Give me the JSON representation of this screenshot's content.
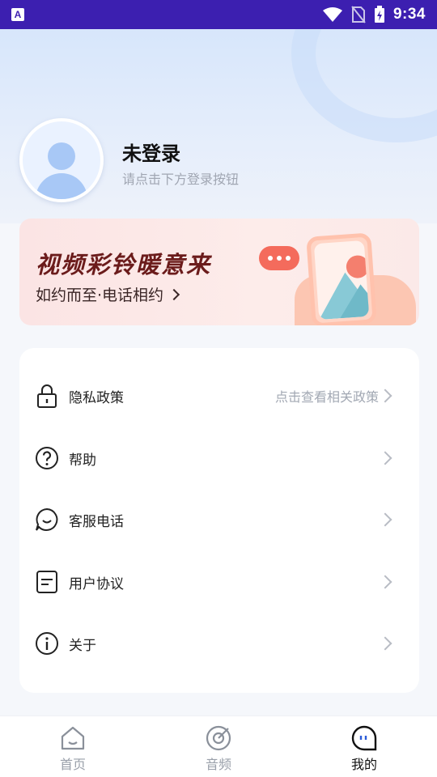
{
  "status_bar": {
    "time": "9:34",
    "app_badge": "A"
  },
  "profile": {
    "title": "未登录",
    "subtitle": "请点击下方登录按钮"
  },
  "banner": {
    "title": "视频彩铃暖意来",
    "subtitle": "如约而至·电话相约"
  },
  "menu": {
    "items": [
      {
        "label": "隐私政策",
        "hint": "点击查看相关政策",
        "icon": "lock-icon"
      },
      {
        "label": "帮助",
        "hint": "",
        "icon": "question-icon"
      },
      {
        "label": "客服电话",
        "hint": "",
        "icon": "chat-icon"
      },
      {
        "label": "用户协议",
        "hint": "",
        "icon": "document-icon"
      },
      {
        "label": "关于",
        "hint": "",
        "icon": "info-icon"
      }
    ]
  },
  "bottom_nav": {
    "items": [
      {
        "label": "首页",
        "icon": "home-icon",
        "active": false
      },
      {
        "label": "音频",
        "icon": "audio-disc-icon",
        "active": false
      },
      {
        "label": "我的",
        "icon": "profile-bubble-icon",
        "active": true
      }
    ]
  }
}
